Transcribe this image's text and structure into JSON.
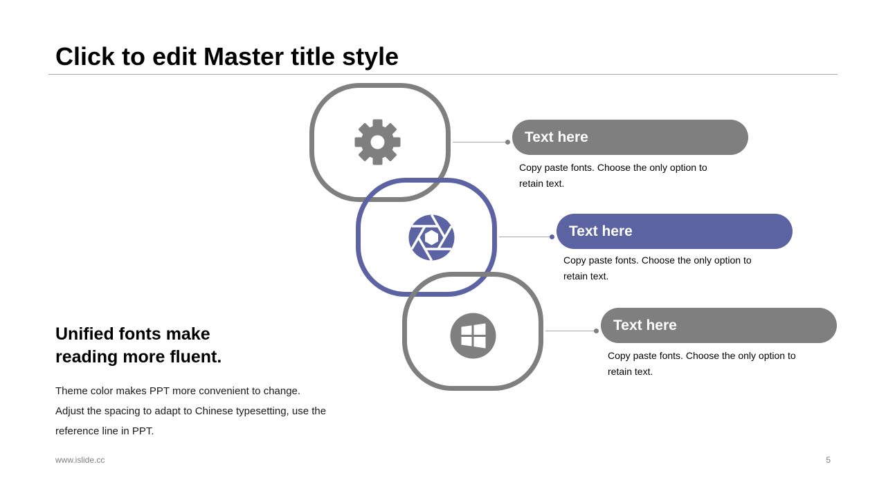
{
  "slide": {
    "title": "Click to edit Master title style",
    "heading_lines": [
      "Unified fonts make",
      "reading more fluent."
    ],
    "body_lines": [
      "Theme color makes PPT more convenient to change.",
      "Adjust the spacing to adapt to Chinese typesetting, use the",
      "reference line in PPT."
    ],
    "footer_url": "www.islide.cc",
    "page_number": "5"
  },
  "colors": {
    "gray": "#7f7f7f",
    "accent": "#5b63a3",
    "rule": "#a6a6a6"
  },
  "items": [
    {
      "icon": "gear-icon",
      "label": "Text here",
      "color": "#7f7f7f",
      "desc_lines": [
        "Copy paste fonts. Choose the only option to",
        "retain text."
      ]
    },
    {
      "icon": "camera-aperture-icon",
      "label": "Text here",
      "color": "#5b63a3",
      "desc_lines": [
        "Copy paste fonts. Choose the only option to",
        "retain text."
      ]
    },
    {
      "icon": "windows-logo-icon",
      "label": "Text here",
      "color": "#7f7f7f",
      "desc_lines": [
        "Copy paste fonts. Choose the only option to",
        "retain text."
      ]
    }
  ]
}
